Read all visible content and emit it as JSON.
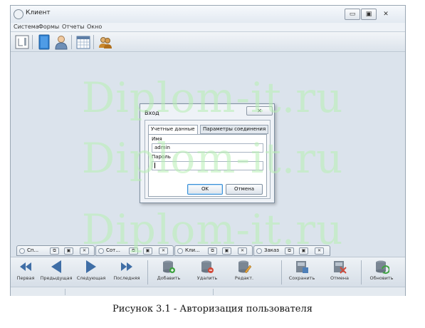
{
  "window": {
    "title": "Клиент",
    "controls": [
      "minimize",
      "maximize",
      "close"
    ]
  },
  "menu": [
    "Система",
    "Формы",
    "Отчеты",
    "Окно"
  ],
  "toolbar": {
    "icons": [
      "report-icon",
      "book-icon",
      "person-icon",
      "calendar-icon",
      "users-icon"
    ]
  },
  "dialog": {
    "title": "Вход",
    "tabs": [
      "Учетные данные",
      "Параметры соединения"
    ],
    "active_tab": 0,
    "name_label": "Имя",
    "name_value": "admin",
    "password_label": "Пароль",
    "password_value": "",
    "ok_label": "OK",
    "cancel_label": "Отмена"
  },
  "mdi_tabs": [
    "Сп...",
    "Сот...",
    "Кли...",
    "Заказ"
  ],
  "nav_buttons": {
    "first": "Первая",
    "prev": "Предыдущая",
    "next": "Следующая",
    "last": "Последняя",
    "add": "Добавить",
    "delete": "Удалить",
    "edit": "Редакт.",
    "save": "Сохранить",
    "cancel": "Отмена",
    "refresh": "Обновить"
  },
  "watermark": "Diplom-it.ru",
  "caption": "Рисунок 3.1 - Авторизация пользователя",
  "colors": {
    "accent": "#3b8fd6",
    "workspace": "#dbe3ec",
    "watermark": "#b7f0b3"
  }
}
